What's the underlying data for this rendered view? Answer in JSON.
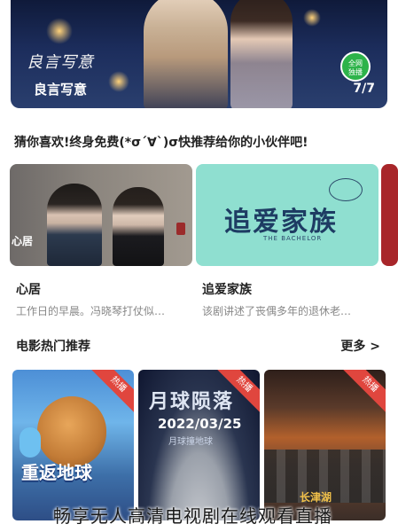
{
  "banner": {
    "calligraphy": "良言写意",
    "title": "良言写意",
    "badge": "全网\n独播",
    "counter": "7/7"
  },
  "recommend_text": "猜你喜欢!终身免费(*σ´∀`)σ快推荐给你的小伙伴吧!",
  "cards": [
    {
      "poster_tag": "心居",
      "title": "心居",
      "desc": "工作日的早晨。冯晓琴打仗似…"
    },
    {
      "poster_title": "追爱家族",
      "poster_subtitle": "THE BACHELOR",
      "title": "追爱家族",
      "desc": "该剧讲述了丧偶多年的退休老…"
    }
  ],
  "movies_section": {
    "title": "电影热门推荐",
    "more": "更多 >"
  },
  "movies": [
    {
      "ribbon": "热播",
      "logo": "重返地球"
    },
    {
      "ribbon": "热播",
      "title": "月球陨落",
      "date": "2022/03/25",
      "sub": "月球撞地球"
    },
    {
      "ribbon": "热播",
      "logo": "长津湖"
    }
  ],
  "watermark": "畅享无人高清电视剧在线观看直播",
  "colors": {
    "ribbon": "#e0463e",
    "badge": "#2db34a",
    "card2_bg": "#8fdfd0"
  }
}
